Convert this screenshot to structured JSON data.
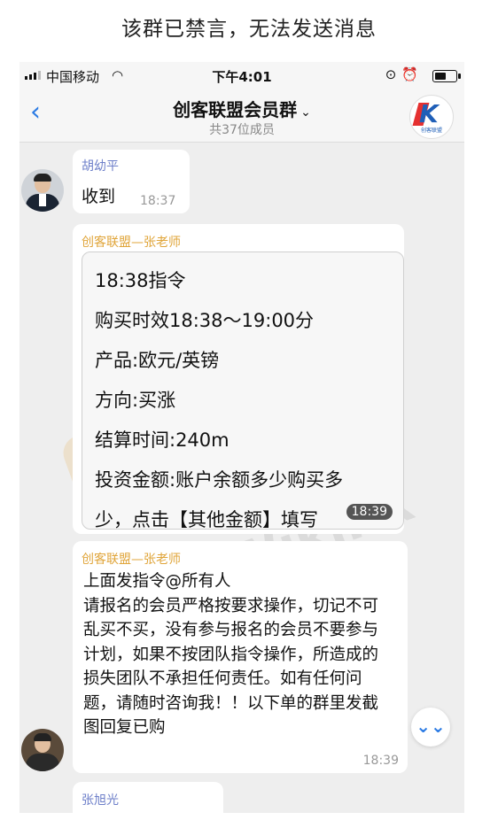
{
  "caption": "该群已禁言，无法发送消息",
  "status_bar": {
    "carrier": "中国移动",
    "time": "下午4:01",
    "signal_bars": 3,
    "battery_level": 0.6
  },
  "nav": {
    "back_icon": "chevron-left-icon",
    "title": "创客联盟会员群",
    "chevron": "⌄",
    "subtitle": "共37位成员",
    "logo_text": "创客联盟"
  },
  "messages": [
    {
      "sender": "胡幼平",
      "text": "收到",
      "time": "18:37"
    },
    {
      "sender": "创客联盟—张老师",
      "lines": [
        "18:38指令",
        "购买时效18:38～19:00分",
        "产品:欧元/英镑",
        "方向:买涨",
        "结算时间:240m",
        "投资金额:账户余额多少购买多",
        "少，点击【其他金额】填写"
      ],
      "time": "18:39"
    },
    {
      "sender": "创客联盟—张老师",
      "text": "上面发指令@所有人\n请报名的会员严格按要求操作，切记不可乱买不买，没有参与报名的会员不要参与计划，如果不按团队指令操作，所造成的损失团队不承担任何责任。如有任何问题，请随时咨询我！！以下单的群里发截图回复已购",
      "time": "18:39"
    },
    {
      "sender": "张旭光"
    }
  ],
  "watermark": "WikiFX",
  "colors": {
    "accent": "#2b7be4",
    "sender_name": "#e0a53a",
    "chat_bg": "#eeeeee"
  }
}
